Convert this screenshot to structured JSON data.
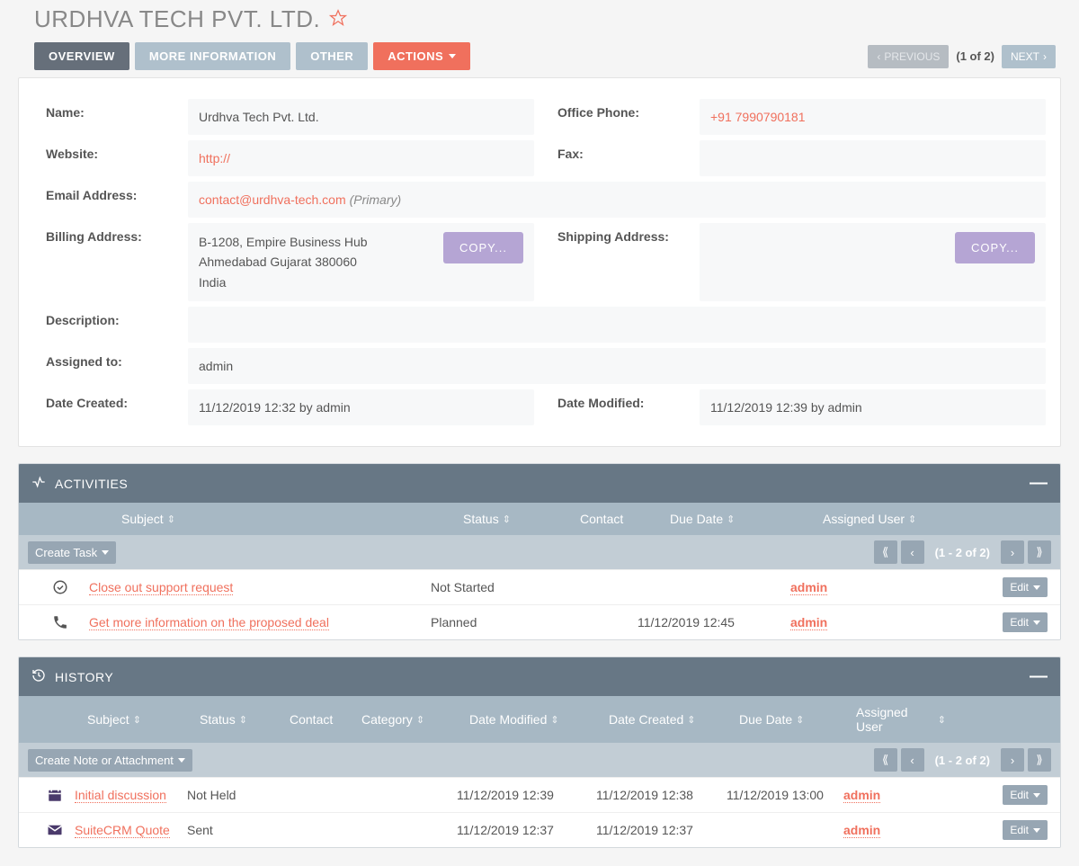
{
  "header": {
    "title": "URDHVA TECH PVT. LTD."
  },
  "tabs": {
    "overview": "OVERVIEW",
    "more_info": "MORE INFORMATION",
    "other": "OTHER",
    "actions": "ACTIONS"
  },
  "pager": {
    "prev": "PREVIOUS",
    "count": "(1 of 2)",
    "next": "NEXT"
  },
  "fields": {
    "name_label": "Name:",
    "name_value": "Urdhva Tech Pvt. Ltd.",
    "office_phone_label": "Office Phone:",
    "office_phone_value": "+91 7990790181",
    "website_label": "Website:",
    "website_value": "http://",
    "fax_label": "Fax:",
    "fax_value": "",
    "email_label": "Email Address:",
    "email_value": "contact@urdhva-tech.com",
    "email_suffix": "(Primary)",
    "billing_label": "Billing Address:",
    "billing_line1": "B-1208, Empire Business Hub",
    "billing_line2": "Ahmedabad Gujarat   380060",
    "billing_line3": "India",
    "shipping_label": "Shipping Address:",
    "copy_btn": "COPY...",
    "description_label": "Description:",
    "description_value": "",
    "assigned_label": "Assigned to:",
    "assigned_value": "admin",
    "created_label": "Date Created:",
    "created_value": "11/12/2019 12:32 by admin",
    "modified_label": "Date Modified:",
    "modified_value": "11/12/2019 12:39 by admin"
  },
  "activities": {
    "title": "ACTIVITIES",
    "cols": {
      "subject": "Subject",
      "status": "Status",
      "contact": "Contact",
      "due": "Due Date",
      "assigned": "Assigned User"
    },
    "create_btn": "Create Task",
    "pager": "(1 - 2 of 2)",
    "edit_btn": "Edit",
    "rows": [
      {
        "icon": "task",
        "subject": "Close out support request",
        "status": "Not Started",
        "contact": "",
        "due": "",
        "assigned": "admin"
      },
      {
        "icon": "call",
        "subject": "Get more information on the proposed deal",
        "status": "Planned",
        "contact": "",
        "due": "11/12/2019 12:45",
        "assigned": "admin"
      }
    ]
  },
  "history": {
    "title": "HISTORY",
    "cols": {
      "subject": "Subject",
      "status": "Status",
      "contact": "Contact",
      "category": "Category",
      "datemod": "Date Modified",
      "datecreated": "Date Created",
      "duedate": "Due Date",
      "assigned": "Assigned User"
    },
    "create_btn": "Create Note or Attachment",
    "pager": "(1 - 2 of 2)",
    "edit_btn": "Edit",
    "rows": [
      {
        "icon": "meeting",
        "subject": "Initial discussion",
        "status": "Not Held",
        "contact": "",
        "category": "",
        "datemod": "11/12/2019 12:39",
        "datecreated": "11/12/2019 12:38",
        "duedate": "11/12/2019 13:00",
        "assigned": "admin"
      },
      {
        "icon": "email",
        "subject": "SuiteCRM Quote",
        "status": "Sent",
        "contact": "",
        "category": "",
        "datemod": "11/12/2019 12:37",
        "datecreated": "11/12/2019 12:37",
        "duedate": "",
        "assigned": "admin"
      }
    ]
  }
}
